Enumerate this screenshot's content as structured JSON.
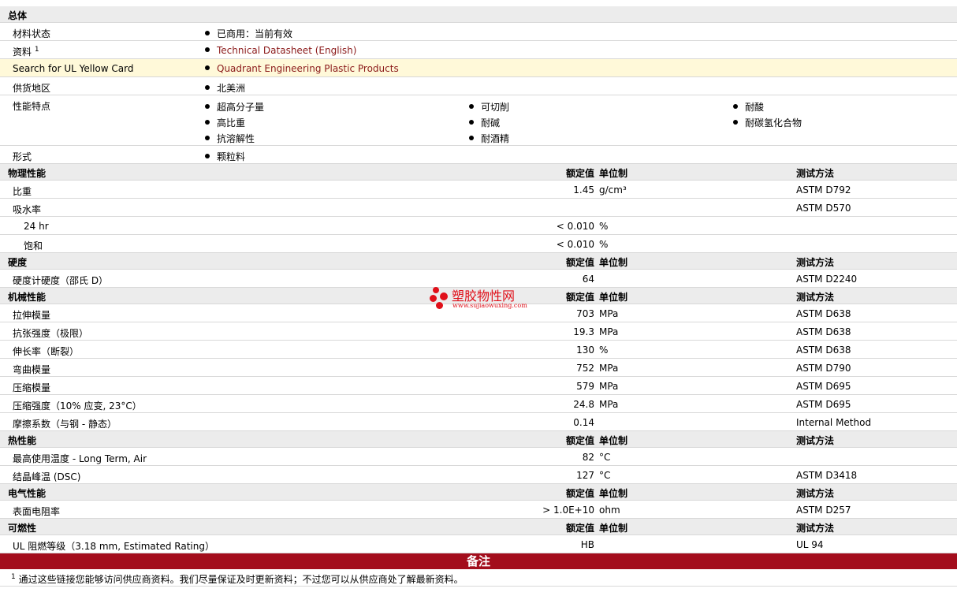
{
  "general": {
    "title": "总体",
    "rows": [
      {
        "label": "材料状态",
        "value": "已商用：当前有效"
      },
      {
        "label": "资料",
        "sup": "1",
        "value": "Technical Datasheet (English)"
      },
      {
        "label": "Search for UL Yellow Card",
        "value": "Quadrant Engineering Plastic Products"
      },
      {
        "label": "供货地区",
        "value": "北美洲"
      }
    ],
    "features_label": "性能特点",
    "features_col1": [
      "超高分子量",
      "高比重",
      "抗溶解性"
    ],
    "features_col2": [
      "可切削",
      "耐碱",
      "耐酒精"
    ],
    "features_col3": [
      "耐酸",
      "耐碳氢化合物"
    ],
    "form_label": "形式",
    "form_value": "颗粒料"
  },
  "headers": {
    "nominal": "额定值",
    "unit": "单位制",
    "method": "测试方法"
  },
  "sections": [
    {
      "title": "物理性能",
      "rows": [
        {
          "label": "比重",
          "nominal": "1.45",
          "unit": "g/cm³",
          "method": "ASTM D792"
        },
        {
          "label": "吸水率",
          "nominal": "",
          "unit": "",
          "method": "ASTM D570"
        },
        {
          "label": "24 hr",
          "sub": true,
          "nominal": "< 0.010",
          "unit": "%",
          "method": ""
        },
        {
          "label": "饱和",
          "sub": true,
          "nominal": "< 0.010",
          "unit": "%",
          "method": ""
        }
      ]
    },
    {
      "title": "硬度",
      "rows": [
        {
          "label": "硬度计硬度（邵氏 D）",
          "nominal": "64",
          "unit": "",
          "method": "ASTM D2240"
        }
      ]
    },
    {
      "title": "机械性能",
      "rows": [
        {
          "label": "拉伸模量",
          "nominal": "703",
          "unit": "MPa",
          "method": "ASTM D638"
        },
        {
          "label": "抗张强度（极限）",
          "nominal": "19.3",
          "unit": "MPa",
          "method": "ASTM D638"
        },
        {
          "label": "伸长率（断裂）",
          "nominal": "130",
          "unit": "%",
          "method": "ASTM D638"
        },
        {
          "label": "弯曲模量",
          "nominal": "752",
          "unit": "MPa",
          "method": "ASTM D790"
        },
        {
          "label": "压缩模量",
          "nominal": "579",
          "unit": "MPa",
          "method": "ASTM D695"
        },
        {
          "label": "压缩强度（10% 应变, 23°C）",
          "nominal": "24.8",
          "unit": "MPa",
          "method": "ASTM D695"
        },
        {
          "label": "摩擦系数（与钢 - 静态）",
          "nominal": "0.14",
          "unit": "",
          "method": "Internal Method"
        }
      ]
    },
    {
      "title": "热性能",
      "rows": [
        {
          "label": "最高使用温度 - Long Term, Air",
          "nominal": "82",
          "unit": "°C",
          "method": ""
        },
        {
          "label": "结晶峰温 (DSC)",
          "nominal": "127",
          "unit": "°C",
          "method": "ASTM D3418"
        }
      ]
    },
    {
      "title": "电气性能",
      "rows": [
        {
          "label": "表面电阻率",
          "nominal": "> 1.0E+10",
          "unit": "ohm",
          "method": "ASTM D257"
        }
      ]
    },
    {
      "title": "可燃性",
      "rows": [
        {
          "label": "UL 阻燃等级（3.18 mm, Estimated Rating）",
          "nominal": "HB",
          "unit": "",
          "method": "UL 94"
        }
      ]
    }
  ],
  "notes": {
    "title": "备注",
    "sup": "1",
    "text": "通过这些链接您能够访问供应商资料。我们尽量保证及时更新资料；不过您可以从供应商处了解最新资料。"
  },
  "watermark": {
    "text": "塑胶物性网",
    "url": "www.sujiaowuxing.com",
    "color": "#e0101a"
  }
}
